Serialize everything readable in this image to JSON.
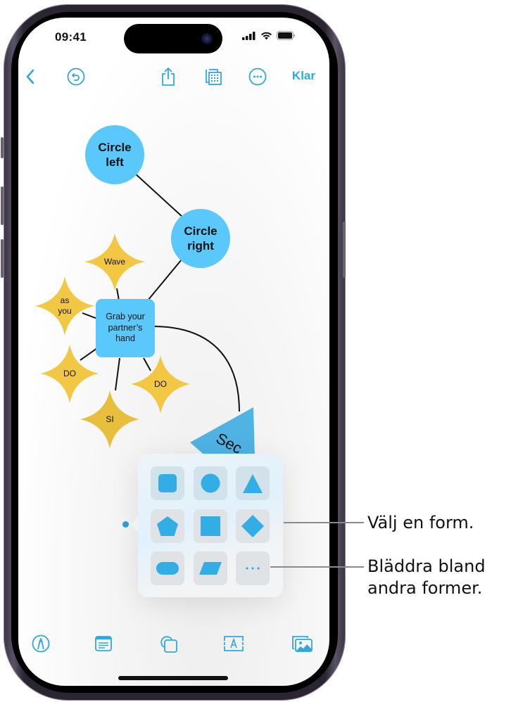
{
  "status_bar": {
    "time": "09:41",
    "icons": [
      "cellular-signal-icon",
      "wifi-icon",
      "battery-icon"
    ]
  },
  "toolbar": {
    "back_icon": "chevron-left-icon",
    "undo_icon": "undo-icon",
    "share_icon": "share-icon",
    "view_icon": "grid-view-icon",
    "more_icon": "ellipsis-circle-icon",
    "done_label": "Klar"
  },
  "diagram": {
    "nodes": [
      {
        "id": "circle-left",
        "shape": "circle",
        "label_line1": "Circle",
        "label_line2": "left"
      },
      {
        "id": "circle-right",
        "shape": "circle",
        "label_line1": "Circle",
        "label_line2": "right"
      },
      {
        "id": "grab",
        "shape": "rounded-rect",
        "label_line1": "Grab your",
        "label_line2": "partner’s",
        "label_line3": "hand"
      },
      {
        "id": "wave",
        "shape": "star",
        "label": "Wave"
      },
      {
        "id": "as-you",
        "shape": "star",
        "label_line1": "as",
        "label_line2": "you"
      },
      {
        "id": "do-left",
        "shape": "star",
        "label": "DO"
      },
      {
        "id": "si",
        "shape": "star",
        "label": "SI"
      },
      {
        "id": "do-right",
        "shape": "star",
        "label": "DO"
      },
      {
        "id": "triangle",
        "shape": "triangle",
        "label": "Sec"
      }
    ],
    "colors": {
      "blue": "#5ac8fa",
      "yellow": "#f2c744",
      "triangle": "#4fb3e3",
      "line": "#111111"
    }
  },
  "shape_picker": {
    "shapes": [
      {
        "name": "rounded-square",
        "label": "Rounded square"
      },
      {
        "name": "circle",
        "label": "Circle"
      },
      {
        "name": "triangle",
        "label": "Triangle"
      },
      {
        "name": "pentagon",
        "label": "Pentagon"
      },
      {
        "name": "square",
        "label": "Square"
      },
      {
        "name": "diamond",
        "label": "Diamond"
      },
      {
        "name": "pill",
        "label": "Pill"
      },
      {
        "name": "parallelogram",
        "label": "Parallelogram"
      },
      {
        "name": "more",
        "label": "···"
      }
    ],
    "accent": "#32ade6"
  },
  "bottom_toolbar": {
    "items": [
      "pen-icon",
      "note-card-icon",
      "shapes-icon",
      "text-box-icon",
      "media-icon"
    ]
  },
  "callouts": {
    "choose_shape": "Välj en form.",
    "browse_line1": "Bläddra bland",
    "browse_line2": "andra former."
  }
}
